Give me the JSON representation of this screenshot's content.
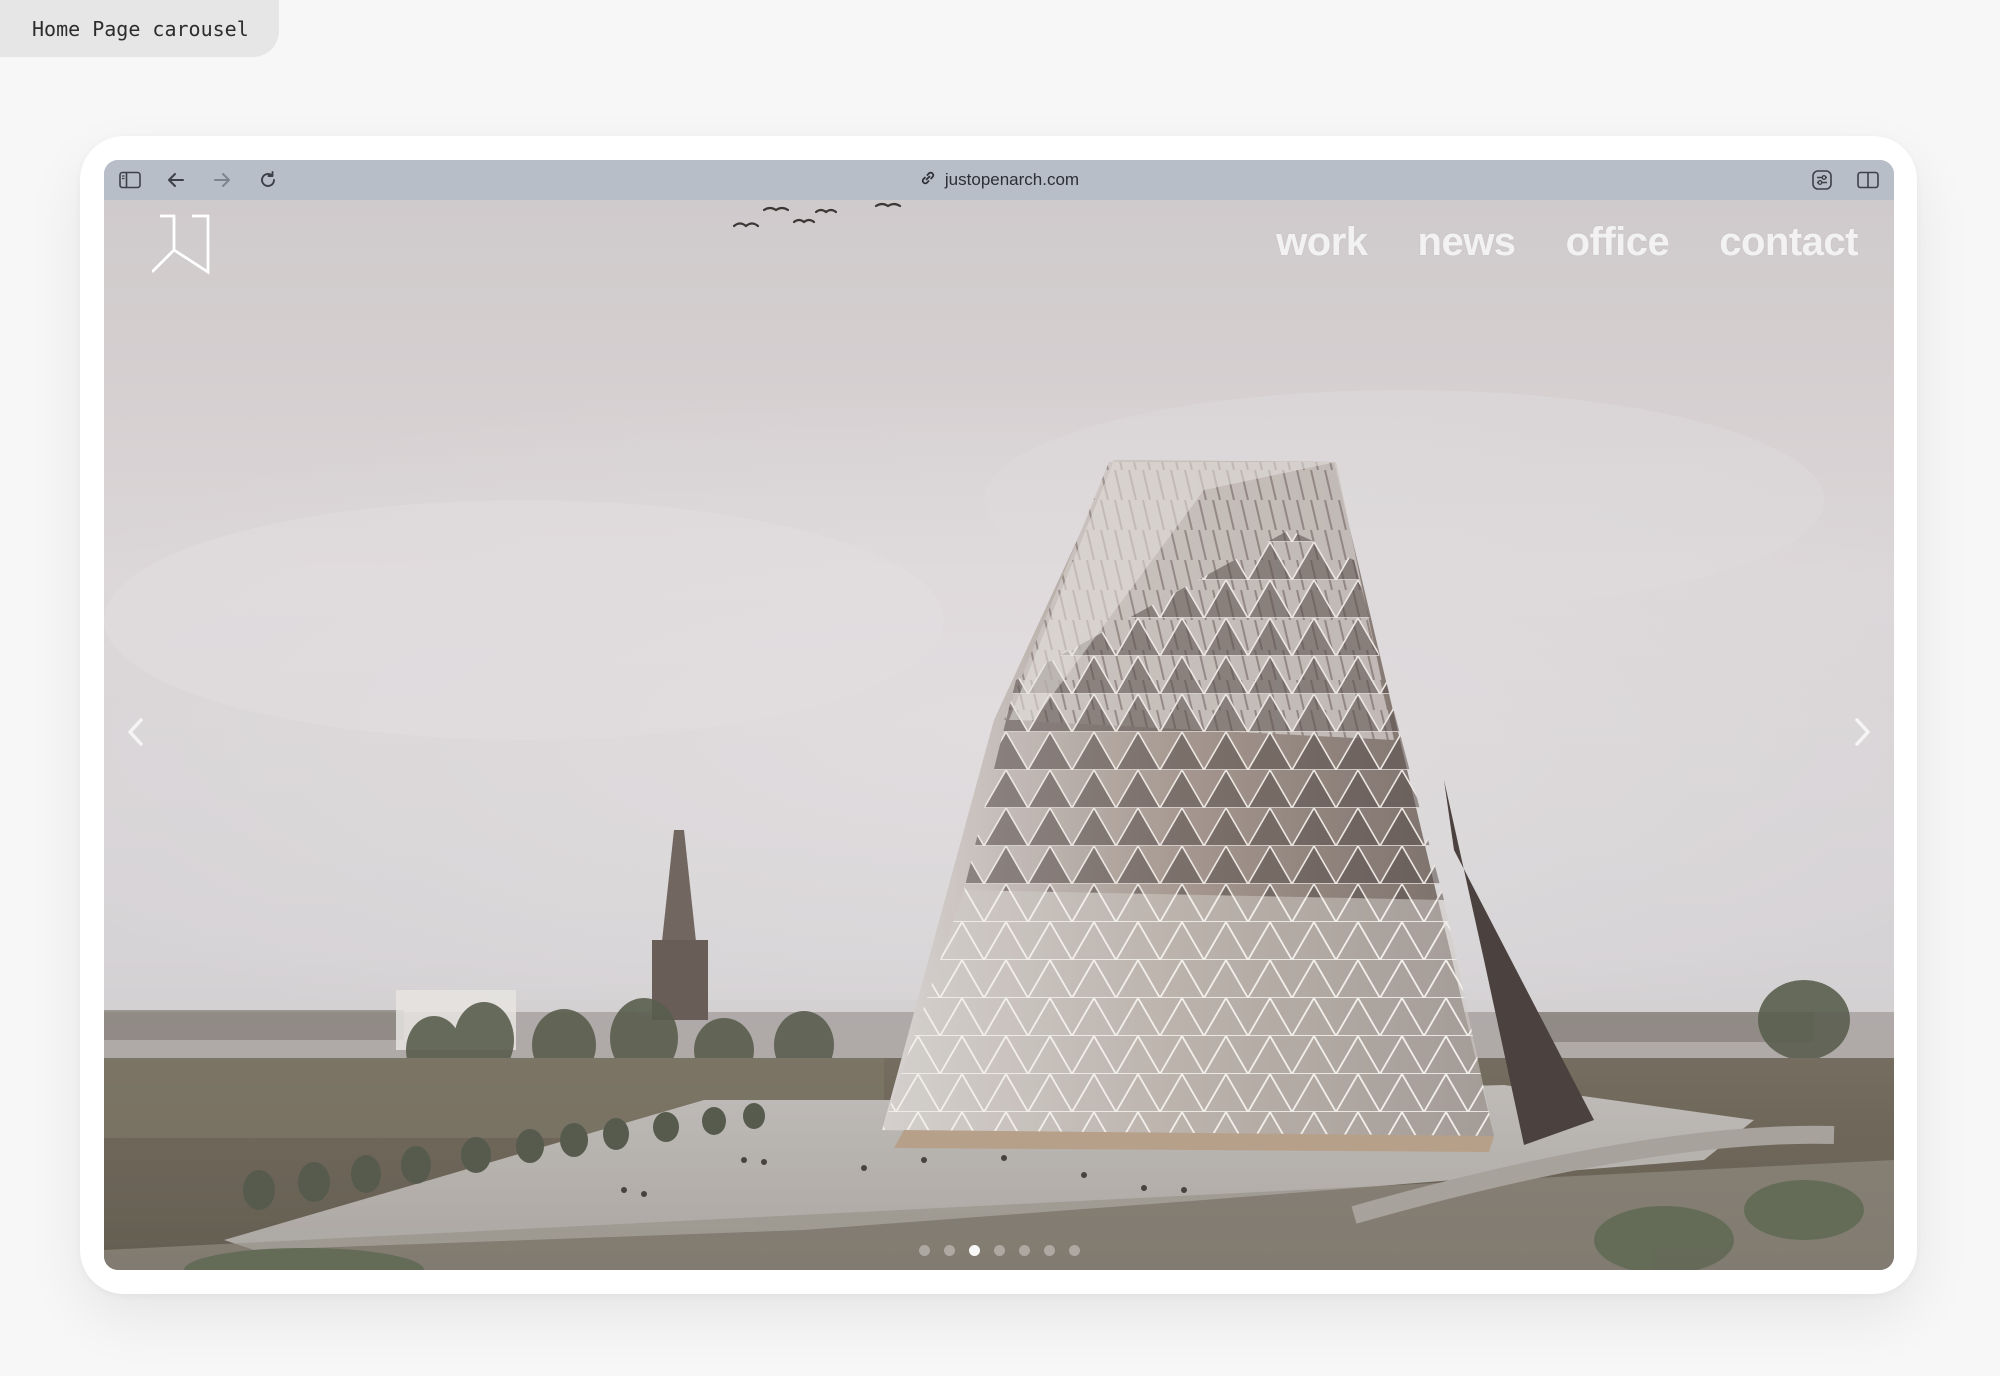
{
  "caption": "Home Page carousel",
  "browser": {
    "url": "justopenarch.com",
    "icons": [
      "sidebar-icon",
      "back-arrow-icon",
      "forward-arrow-icon",
      "reload-icon",
      "link-icon",
      "extension-icon",
      "split-view-icon"
    ]
  },
  "site": {
    "logo_icon": "jo-monogram-logo",
    "nav": [
      {
        "label": "work"
      },
      {
        "label": "news"
      },
      {
        "label": "office"
      },
      {
        "label": "contact"
      }
    ],
    "carousel": {
      "slide_count": 7,
      "active_slide": 3,
      "prev_icon": "chevron-left-icon",
      "next_icon": "chevron-right-icon"
    }
  },
  "colors": {
    "toolbar": "#b8bec8",
    "sky": "#ddd8da",
    "nav_text": "#ffffff"
  }
}
